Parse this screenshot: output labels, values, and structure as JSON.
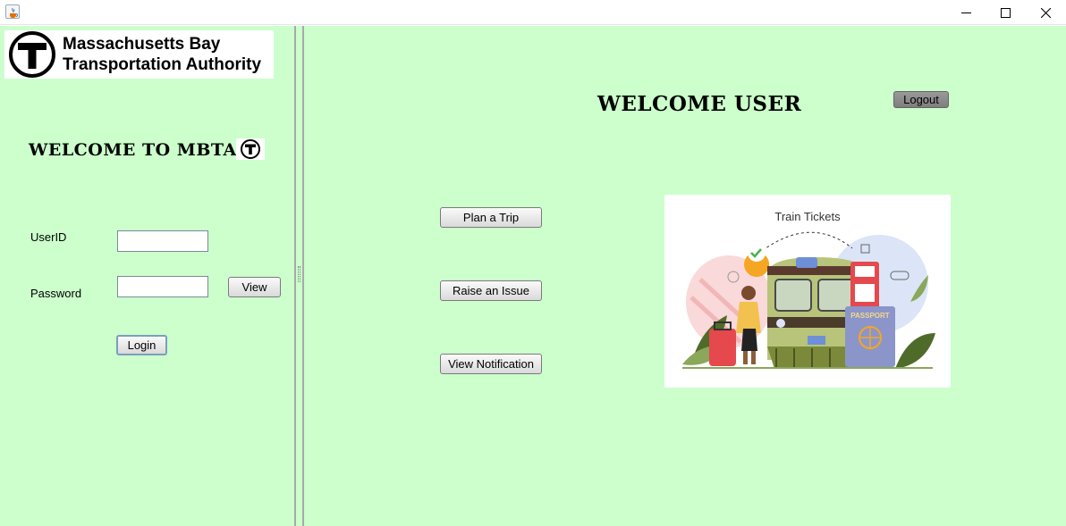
{
  "window": {
    "app_icon": "java-cup-icon",
    "controls": [
      "minimize-icon",
      "maximize-icon",
      "close-icon"
    ]
  },
  "logo": {
    "line1": "Massachusetts Bay",
    "line2": "Transportation Authority",
    "icon": "mbta-t-icon"
  },
  "login": {
    "heading": "WELCOME TO MBTA",
    "userid_label": "UserID",
    "userid_value": "",
    "password_label": "Password",
    "password_value": "",
    "view_label": "View",
    "login_label": "Login"
  },
  "main": {
    "heading": "WELCOME USER",
    "logout_label": "Logout",
    "actions": {
      "plan_trip": "Plan a Trip",
      "raise_issue": "Raise an Issue",
      "view_notification": "View Notification"
    },
    "illustration": {
      "title": "Train Tickets",
      "passport_text": "PASSPORT"
    }
  },
  "colors": {
    "panel_bg": "#ccffcc",
    "logo_black": "#000000"
  }
}
